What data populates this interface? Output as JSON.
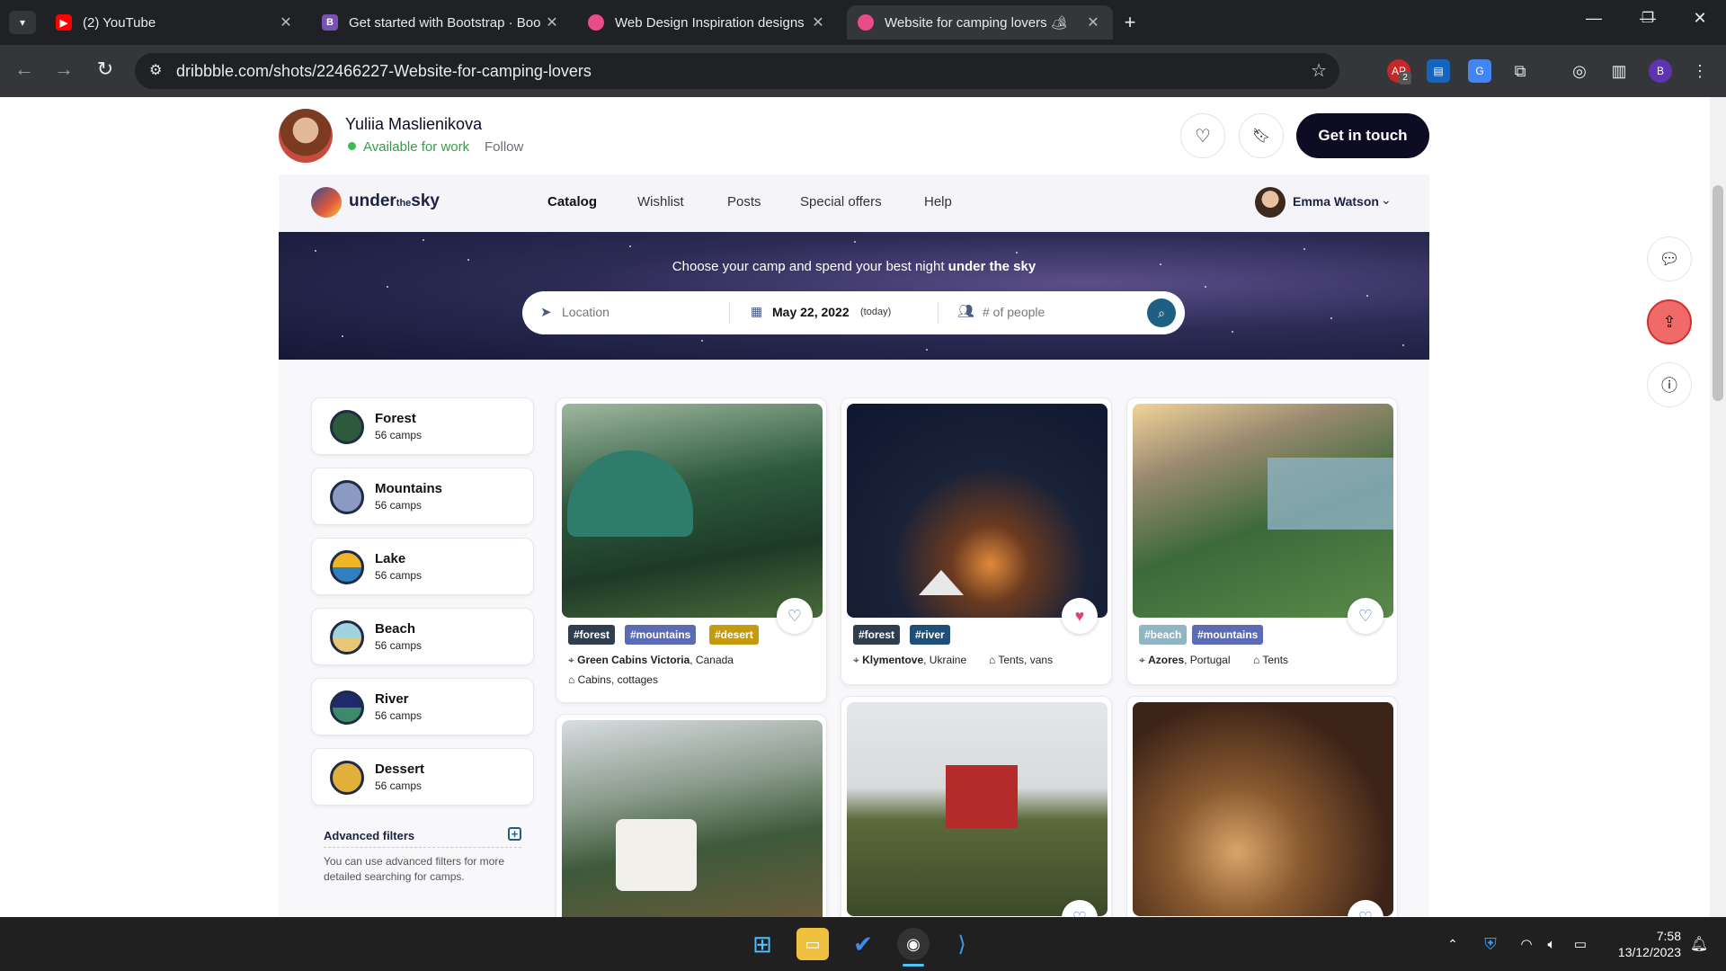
{
  "browser": {
    "tabs": [
      {
        "title": "(2) YouTube",
        "favicon": "youtube-icon",
        "active": false
      },
      {
        "title": "Get started with Bootstrap · Boo",
        "favicon": "bootstrap-icon",
        "active": false
      },
      {
        "title": "Web Design Inspiration designs",
        "favicon": "dribbble-icon",
        "active": false
      },
      {
        "title": "Website for camping lovers 🏕",
        "favicon": "dribbble-icon",
        "active": true
      }
    ],
    "new_tab": "+",
    "url": "dribbble.com/shots/22466227-Website-for-camping-lovers",
    "profile_initial": "B",
    "ext_badge": "2"
  },
  "shot_header": {
    "author": "Yuliia Maslienikova",
    "availability": "Available for work",
    "follow": "Follow",
    "cta": "Get in touch"
  },
  "site": {
    "logo_bold": "under",
    "logo_small": "the",
    "logo_end": "sky",
    "nav": [
      "Catalog",
      "Wishlist",
      "Posts",
      "Special offers",
      "Help"
    ],
    "user": "Emma Watson",
    "hero_prefix": "Choose your camp and spend your best night ",
    "hero_bold": "under the sky",
    "search": {
      "location": "Location",
      "date": "May 22, 2022",
      "date_note": "(today)",
      "people": "# of people"
    },
    "categories": [
      {
        "name": "Forest",
        "count": "56 camps"
      },
      {
        "name": "Mountains",
        "count": "56 camps"
      },
      {
        "name": "Lake",
        "count": "56 camps"
      },
      {
        "name": "Beach",
        "count": "56 camps"
      },
      {
        "name": "River",
        "count": "56 camps"
      },
      {
        "name": "Dessert",
        "count": "56 camps"
      }
    ],
    "advanced": {
      "title": "Advanced filters",
      "desc": "You can use advanced filters for more detailed searching for camps."
    },
    "camps": [
      {
        "tags": [
          "#forest",
          "#mountains",
          "#desert"
        ],
        "place": "Green Cabins Victoria",
        "country": ", Canada",
        "type": "Cabins, cottages",
        "liked": false
      },
      {
        "tags": [
          "#forest",
          "#river"
        ],
        "place": "Klymentove",
        "country": ", Ukraine",
        "type": "Tents, vans",
        "liked": true
      },
      {
        "tags": [
          "#beach",
          "#mountains"
        ],
        "place": "Azores",
        "country": ", Portugal",
        "type": "Tents",
        "liked": false
      }
    ]
  },
  "taskbar": {
    "time": "7:58",
    "date": "13/12/2023"
  }
}
